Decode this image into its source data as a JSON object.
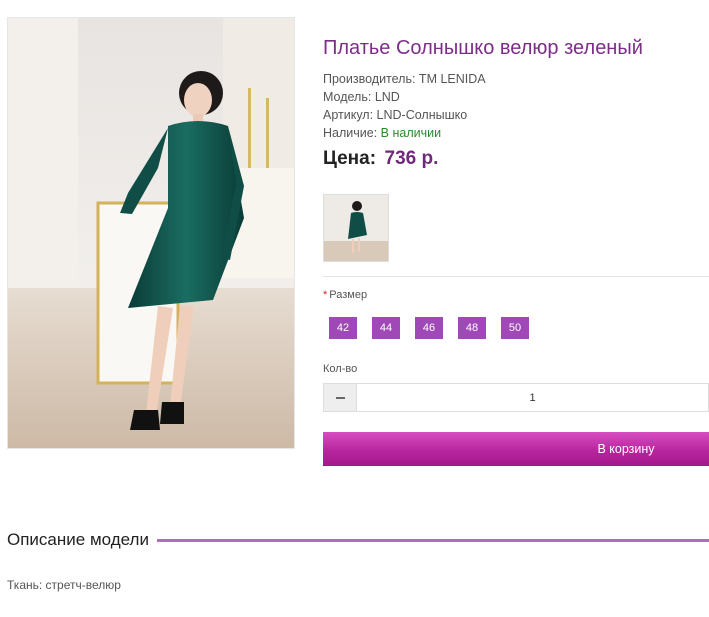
{
  "product": {
    "title": "Платье Солнышко велюр зеленый",
    "manufacturer": "Производитель: ТМ LENIDA",
    "model": "Модель: LND",
    "sku": "Артикул: LND-Солнышко",
    "availability_label": "Наличие: ",
    "availability_value": "В наличии",
    "price_label": "Цена:",
    "price_value": "736 р."
  },
  "options": {
    "size_required_mark": "*",
    "size_label": "Размер",
    "sizes": [
      "42",
      "44",
      "46",
      "48",
      "50"
    ]
  },
  "quantity": {
    "label": "Кол-во",
    "value": "1"
  },
  "cart_button_label": "В корзину",
  "description": {
    "heading": "Описание модели",
    "text": "Ткань: стретч-велюр"
  },
  "colors": {
    "title": "#7b2d88",
    "price": "#6f2b7a",
    "in_stock": "#2a8a2a",
    "size_button": "#a148b8",
    "cart_button": "#b8269f",
    "heading_rule": "#b16bc0",
    "dress": "#0f4d46"
  },
  "icons": {
    "qty_decrease": "minus-icon",
    "product_photo": "green-velour-dress-photo"
  }
}
